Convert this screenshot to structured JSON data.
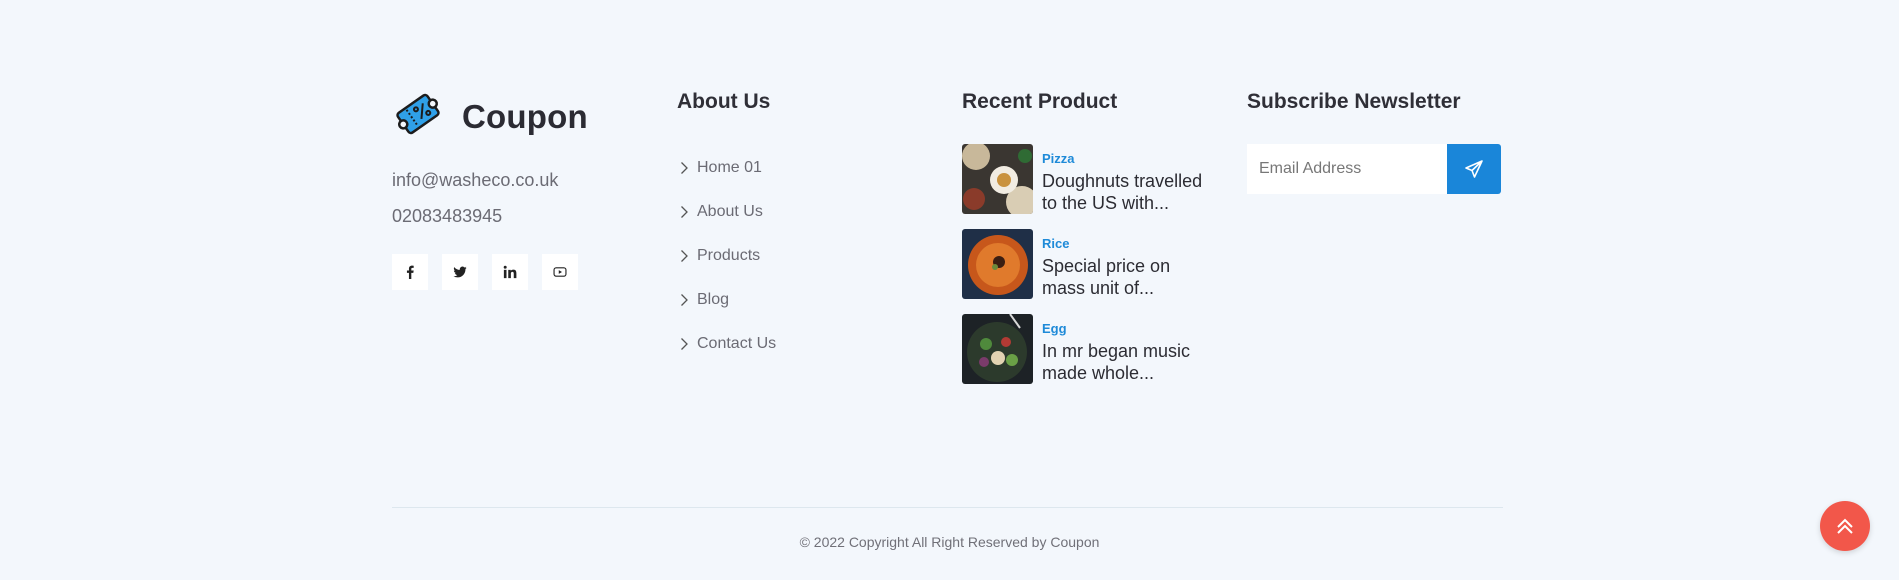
{
  "brand": {
    "name": "Coupon",
    "icon": "coupon-ticket-icon"
  },
  "contact": {
    "email": "info@washeco.co.uk",
    "phone": "02083483945"
  },
  "socials": [
    {
      "icon": "facebook-icon"
    },
    {
      "icon": "twitter-icon"
    },
    {
      "icon": "linkedin-icon"
    },
    {
      "icon": "youtube-icon"
    }
  ],
  "about": {
    "title": "About Us",
    "links": [
      {
        "label": "Home 01"
      },
      {
        "label": "About Us"
      },
      {
        "label": "Products"
      },
      {
        "label": "Blog"
      },
      {
        "label": "Contact Us"
      }
    ]
  },
  "recent": {
    "title": "Recent Product",
    "items": [
      {
        "category": "Pizza",
        "title": "Doughnuts travelled to the US with..."
      },
      {
        "category": "Rice",
        "title": "Special price on mass unit of..."
      },
      {
        "category": "Egg",
        "title": "In mr began music made whole..."
      }
    ]
  },
  "newsletter": {
    "title": "Subscribe Newsletter",
    "placeholder": "Email Address",
    "button_icon": "paper-plane-icon"
  },
  "copyright": "© 2022 Copyright All Right Reserved by Coupon",
  "colors": {
    "accent": "#1a86d9",
    "category": "#1e8ad8",
    "scroll_top": "#f2574a",
    "background": "#f3f7fc"
  }
}
